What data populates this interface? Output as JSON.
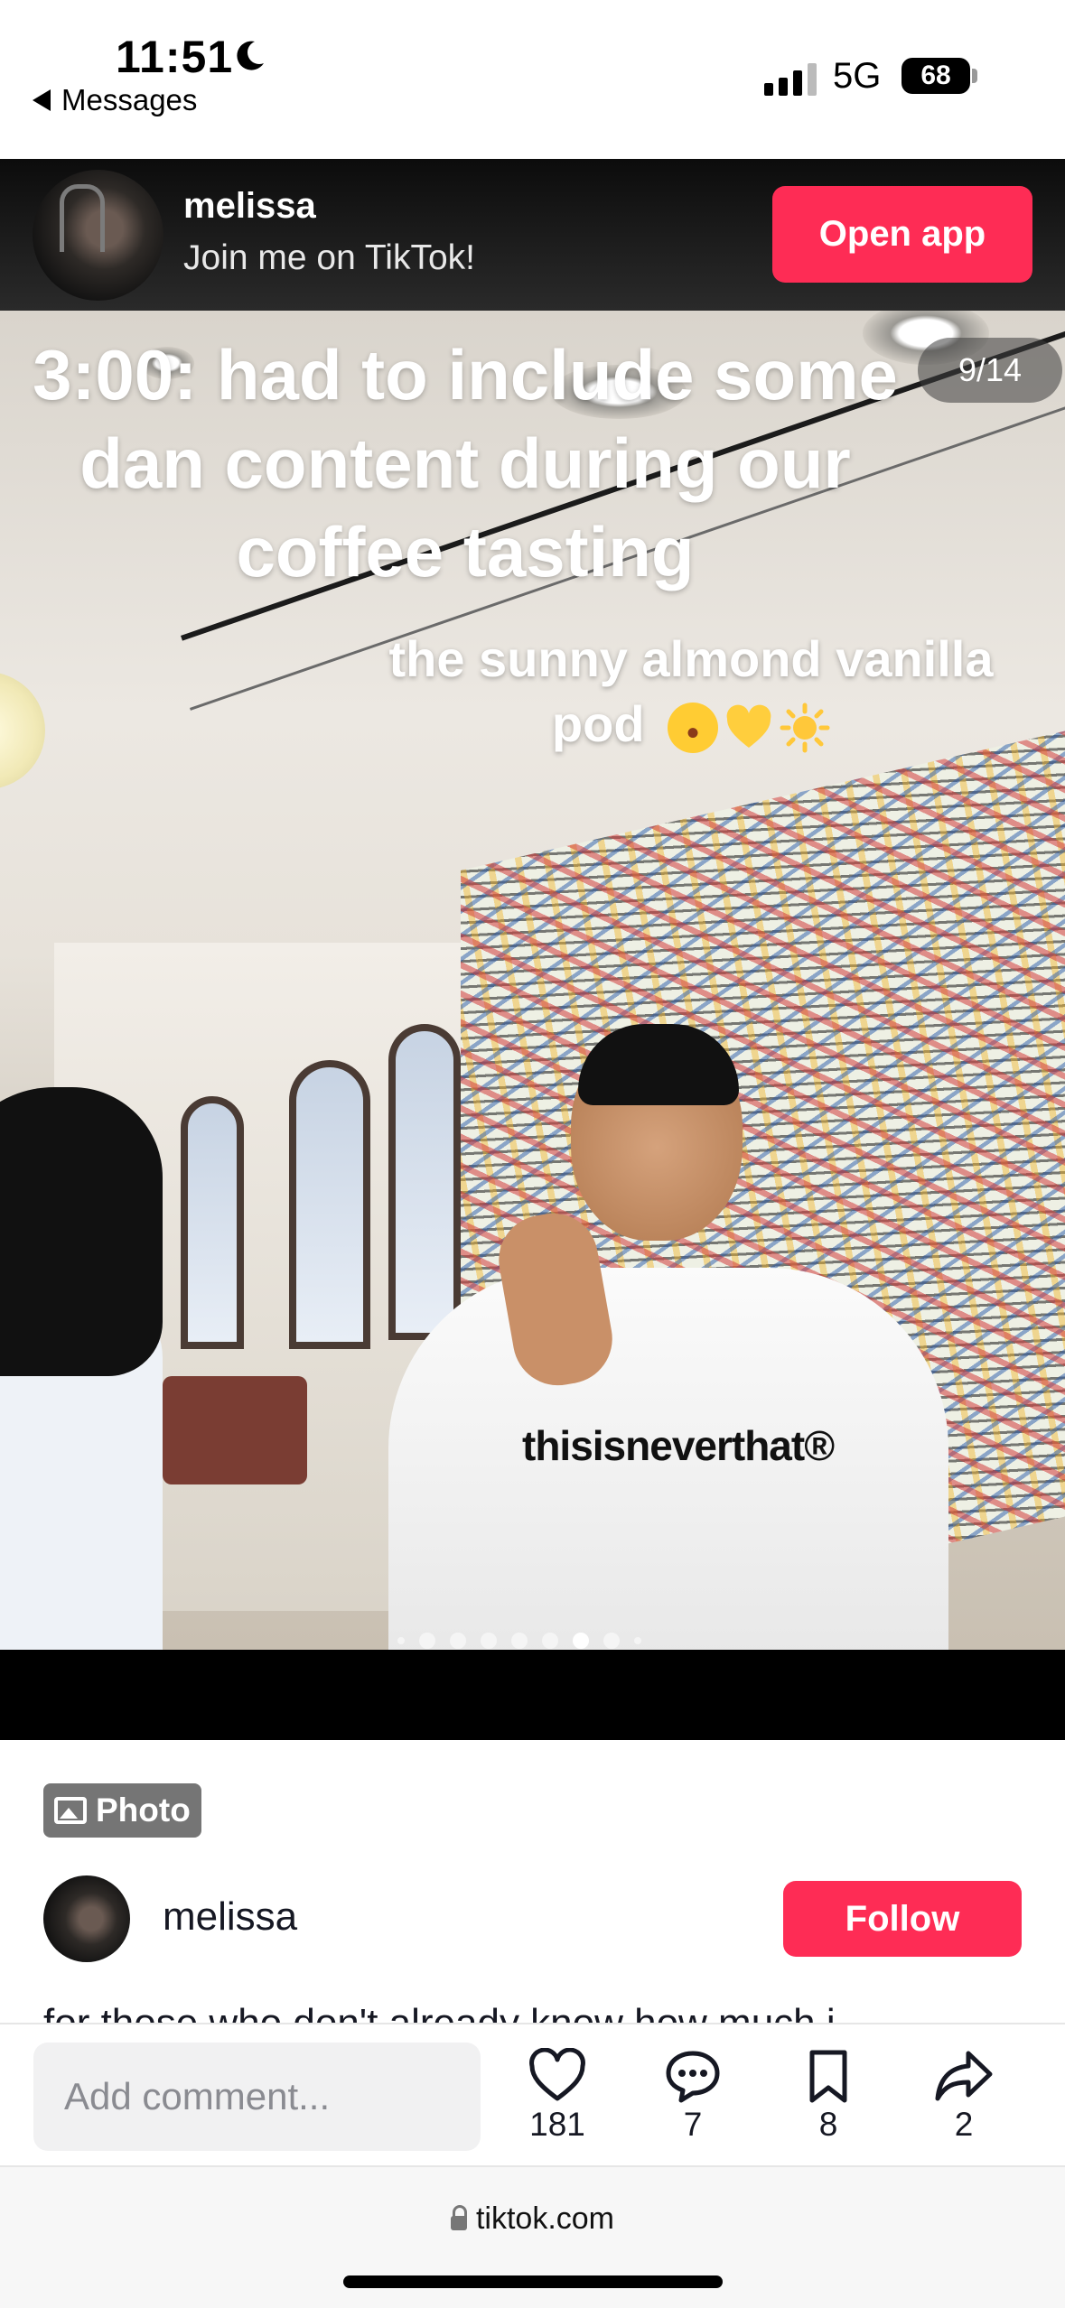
{
  "status_bar": {
    "time": "11:51",
    "back_app": "Messages",
    "network": "5G",
    "battery": "68"
  },
  "banner": {
    "username": "melissa",
    "subtitle": "Join me on TikTok!",
    "open_app_label": "Open app",
    "accent_color": "#fe2c55"
  },
  "photo": {
    "caption_main": "3:00: had to include some dan content during our coffee tasting",
    "caption_sub": "the sunny almond vanilla pod",
    "emoji": [
      "star-struck-emoji",
      "yellow-heart-emoji",
      "sun-emoji"
    ],
    "counter": "9/14",
    "shirt_text": "thisisneverthat®",
    "current_slide": 9,
    "total_slides": 14
  },
  "post": {
    "badge_label": "Photo",
    "author": "melissa",
    "follow_label": "Follow",
    "description": "for those who don't already know how much i"
  },
  "actions": {
    "comment_placeholder": "Add comment...",
    "likes": "181",
    "comments": "7",
    "saves": "8",
    "shares": "2"
  },
  "browser": {
    "url": "tiktok.com"
  }
}
